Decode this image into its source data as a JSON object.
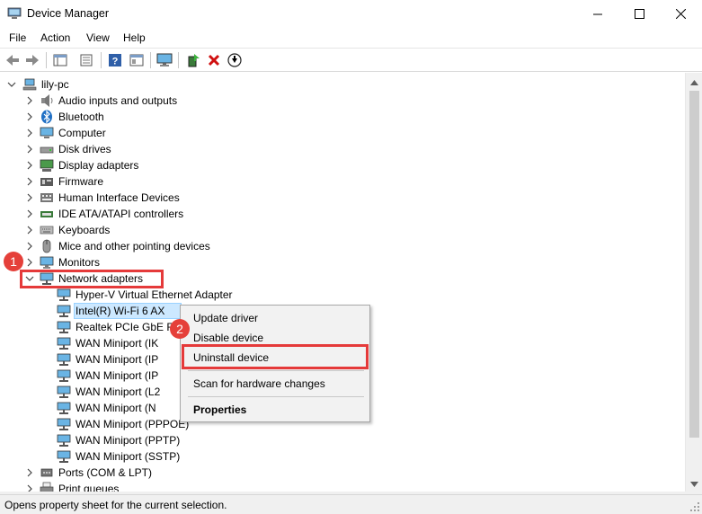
{
  "window": {
    "title": "Device Manager"
  },
  "menu": [
    "File",
    "Action",
    "View",
    "Help"
  ],
  "toolbar": {
    "icons": [
      "back-arrow-icon",
      "forward-arrow-icon",
      "show-hide-tree-icon",
      "properties-icon",
      "help-icon",
      "view-resources-icon",
      "monitor-icon",
      "update-driver-icon",
      "uninstall-x-icon",
      "download-arrow-icon"
    ]
  },
  "tree": {
    "root": "lily-pc",
    "categories": [
      "Audio inputs and outputs",
      "Bluetooth",
      "Computer",
      "Disk drives",
      "Display adapters",
      "Firmware",
      "Human Interface Devices",
      "IDE ATA/ATAPI controllers",
      "Keyboards",
      "Mice and other pointing devices",
      "Monitors",
      "Network adapters"
    ],
    "network_children": [
      "Hyper-V Virtual Ethernet Adapter",
      "Intel(R) Wi-Fi 6 AX",
      "Realtek PCIe GbE F",
      "WAN Miniport (IK",
      "WAN Miniport (IP",
      "WAN Miniport (IP",
      "WAN Miniport (L2",
      "WAN Miniport (N",
      "WAN Miniport (PPPOE)",
      "WAN Miniport (PPTP)",
      "WAN Miniport (SSTP)"
    ],
    "after": [
      "Ports (COM & LPT)",
      "Print queues"
    ]
  },
  "context_menu": {
    "update": "Update driver",
    "disable": "Disable device",
    "uninstall": "Uninstall device",
    "scan": "Scan for hardware changes",
    "properties": "Properties"
  },
  "annotations": {
    "step1": "1",
    "step2": "2",
    "color": "#e53a3a"
  },
  "status": "Opens property sheet for the current selection."
}
